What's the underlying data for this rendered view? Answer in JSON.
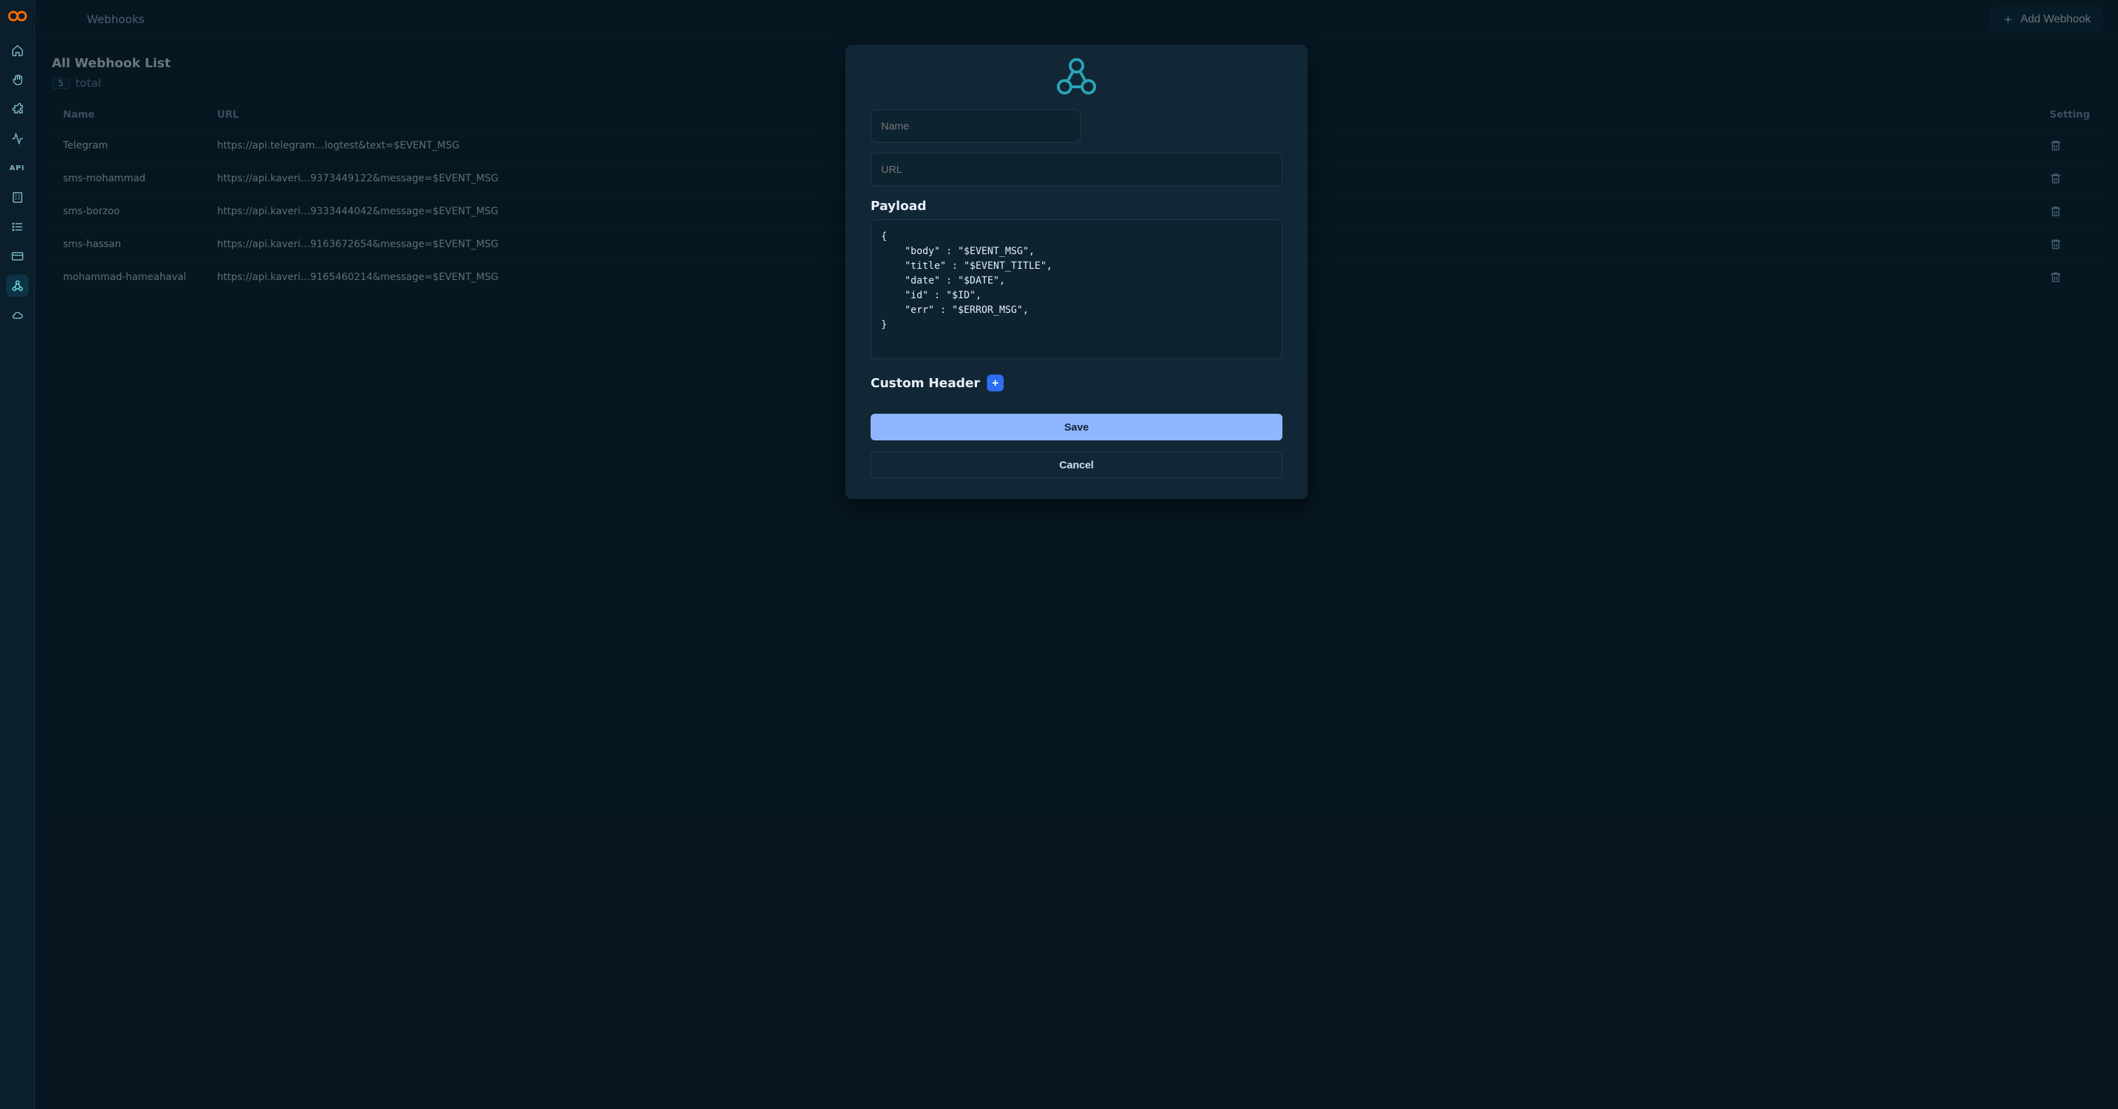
{
  "colors": {
    "accent": "#2aa5b8",
    "primary": "#8fb5ff"
  },
  "sidebar": {
    "logo_name": "brand",
    "items": [
      {
        "name": "home"
      },
      {
        "name": "gesture"
      },
      {
        "name": "plugins"
      },
      {
        "name": "activity"
      },
      {
        "name": "api",
        "label": "API"
      },
      {
        "name": "organization"
      },
      {
        "name": "lists"
      },
      {
        "name": "billing"
      },
      {
        "name": "webhooks",
        "active": true
      },
      {
        "name": "cloud-sync"
      }
    ]
  },
  "topbar": {
    "page_title": "Webhooks",
    "add_btn": "Add Webhook"
  },
  "list": {
    "title": "All Webhook List",
    "count": "5",
    "total_label": "total",
    "columns": {
      "name": "Name",
      "url": "URL",
      "setting": "Setting"
    },
    "rows": [
      {
        "name": "Telegram",
        "url": "https://api.telegram…logtest&text=$EVENT_MSG"
      },
      {
        "name": "sms-mohammad",
        "url": "https://api.kaveri…9373449122&message=$EVENT_MSG"
      },
      {
        "name": "sms-borzoo",
        "url": "https://api.kaveri…9333444042&message=$EVENT_MSG"
      },
      {
        "name": "sms-hassan",
        "url": "https://api.kaveri…9163672654&message=$EVENT_MSG"
      },
      {
        "name": "mohammad-hameahaval",
        "url": "https://api.kaveri…9165460214&message=$EVENT_MSG"
      }
    ]
  },
  "dialog": {
    "name_placeholder": "Name",
    "url_placeholder": "URL",
    "payload_label": "Payload",
    "payload_value": "{\n    \"body\" : \"$EVENT_MSG\",\n    \"title\" : \"$EVENT_TITLE\",\n    \"date\" : \"$DATE\",\n    \"id\" : \"$ID\",\n    \"err\" : \"$ERROR_MSG\",\n}",
    "custom_header_label": "Custom Header",
    "save_label": "Save",
    "cancel_label": "Cancel"
  }
}
